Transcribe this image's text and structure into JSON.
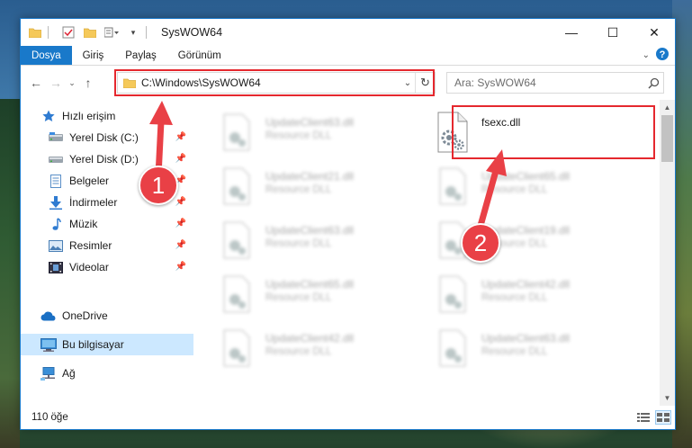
{
  "window": {
    "title": "SysWOW64",
    "controls": {
      "minimize": "—",
      "maximize": "☐",
      "close": "✕"
    }
  },
  "ribbon": {
    "tabs": [
      "Dosya",
      "Giriş",
      "Paylaş",
      "Görünüm"
    ]
  },
  "address": {
    "path": "C:\\Windows\\SysWOW64",
    "search_placeholder": "Ara: SysWOW64"
  },
  "nav": {
    "quick_access": "Hızlı erişim",
    "pinned": [
      {
        "label": "Yerel Disk (C:)",
        "icon": "drive-icon"
      },
      {
        "label": "Yerel Disk (D:)",
        "icon": "drive-icon"
      },
      {
        "label": "Belgeler",
        "icon": "documents-icon"
      },
      {
        "label": "İndirmeler",
        "icon": "download-icon"
      },
      {
        "label": "Müzik",
        "icon": "music-icon"
      },
      {
        "label": "Resimler",
        "icon": "pictures-icon"
      },
      {
        "label": "Videolar",
        "icon": "videos-icon"
      }
    ],
    "onedrive": "OneDrive",
    "this_pc": "Bu bilgisayar",
    "network": "Ağ"
  },
  "files": {
    "left_column": [
      {
        "name": "UpdateClient63.dll",
        "type": "Resource DLL"
      },
      {
        "name": "UpdateClient21.dll",
        "type": "Resource DLL"
      },
      {
        "name": "UpdateClient63.dll",
        "type": "Resource DLL"
      },
      {
        "name": "UpdateClient65.dll",
        "type": "Resource DLL"
      },
      {
        "name": "UpdateClient42.dll",
        "type": "Resource DLL"
      }
    ],
    "right_column": [
      {
        "name": "fsexc.dll",
        "type": ""
      },
      {
        "name": "UpdateClient65.dll",
        "type": "Resource DLL"
      },
      {
        "name": "UpdateClient19.dll",
        "type": "Resource DLL"
      },
      {
        "name": "UpdateClient42.dll",
        "type": "Resource DLL"
      },
      {
        "name": "UpdateClient63.dll",
        "type": "Resource DLL"
      }
    ]
  },
  "status": {
    "item_count": "110 öğe"
  },
  "annotations": {
    "step1": "1",
    "step2": "2"
  },
  "colors": {
    "accent": "#1979ca",
    "highlight": "#e5282e",
    "badge": "#e94046",
    "selected": "#cce8ff"
  }
}
